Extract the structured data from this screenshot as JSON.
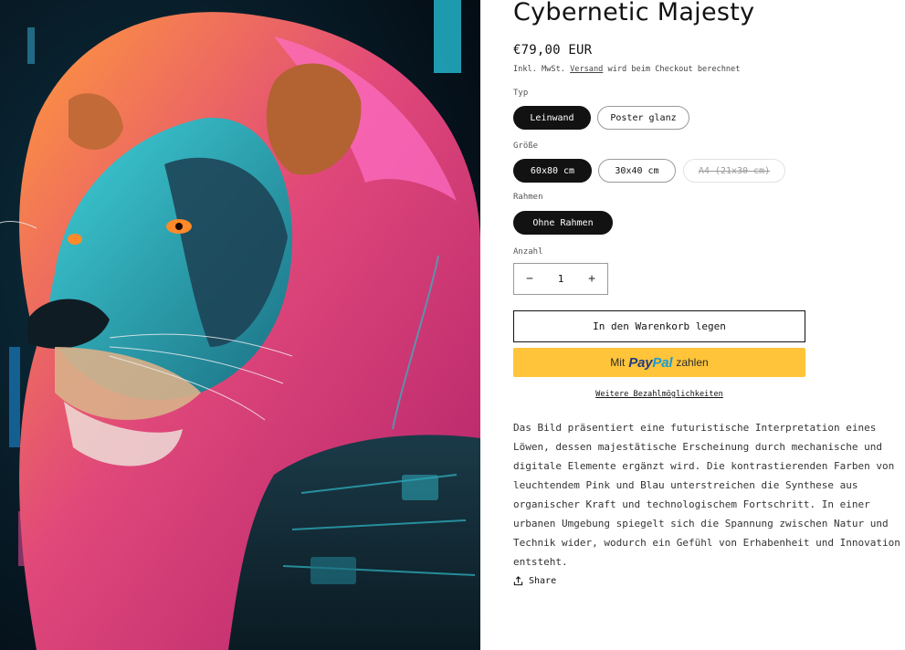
{
  "artwork": {
    "alt": "Cybernetic lion artwork"
  },
  "product": {
    "title": "Cybernetic Majesty",
    "price": "€79,00 EUR",
    "tax_prefix": "Inkl. MwSt.",
    "tax_link": "Versand",
    "tax_suffix": "wird beim Checkout berechnet"
  },
  "options": {
    "type": {
      "label": "Typ",
      "values": [
        "Leinwand",
        "Poster glanz"
      ],
      "selected": "Leinwand"
    },
    "size": {
      "label": "Größe",
      "values": [
        "60x80 cm",
        "30x40 cm",
        "A4 (21x30 cm)"
      ],
      "selected": "60x80 cm",
      "unavailable": [
        "A4 (21x30 cm)"
      ]
    },
    "frame": {
      "label": "Rahmen",
      "values": [
        "Ohne Rahmen"
      ],
      "selected": "Ohne Rahmen"
    }
  },
  "quantity": {
    "label": "Anzahl",
    "value": "1",
    "minus": "−",
    "plus": "+"
  },
  "buttons": {
    "add_to_cart": "In den Warenkorb legen",
    "paypal_prefix": "Mit",
    "paypal_brand_a": "Pay",
    "paypal_brand_b": "Pal",
    "paypal_suffix": "zahlen",
    "more_payment": "Weitere Bezahlmöglichkeiten",
    "share": "Share"
  },
  "description": "Das Bild präsentiert eine futuristische Interpretation eines Löwen, dessen majestätische Erscheinung durch mechanische und digitale Elemente ergänzt wird. Die kontrastierenden Farben von leuchtendem Pink und Blau unterstreichen die Synthese aus organischer Kraft und technologischem Fortschritt. In einer urbanen Umgebung spiegelt sich die Spannung zwischen Natur und Technik wider, wodurch ein Gefühl von Erhabenheit und Innovation entsteht.",
  "colors": {
    "accent": "#121212",
    "paypal_yellow": "#ffc439",
    "paypal_dark_blue": "#253b80",
    "paypal_light_blue": "#179bd7"
  }
}
